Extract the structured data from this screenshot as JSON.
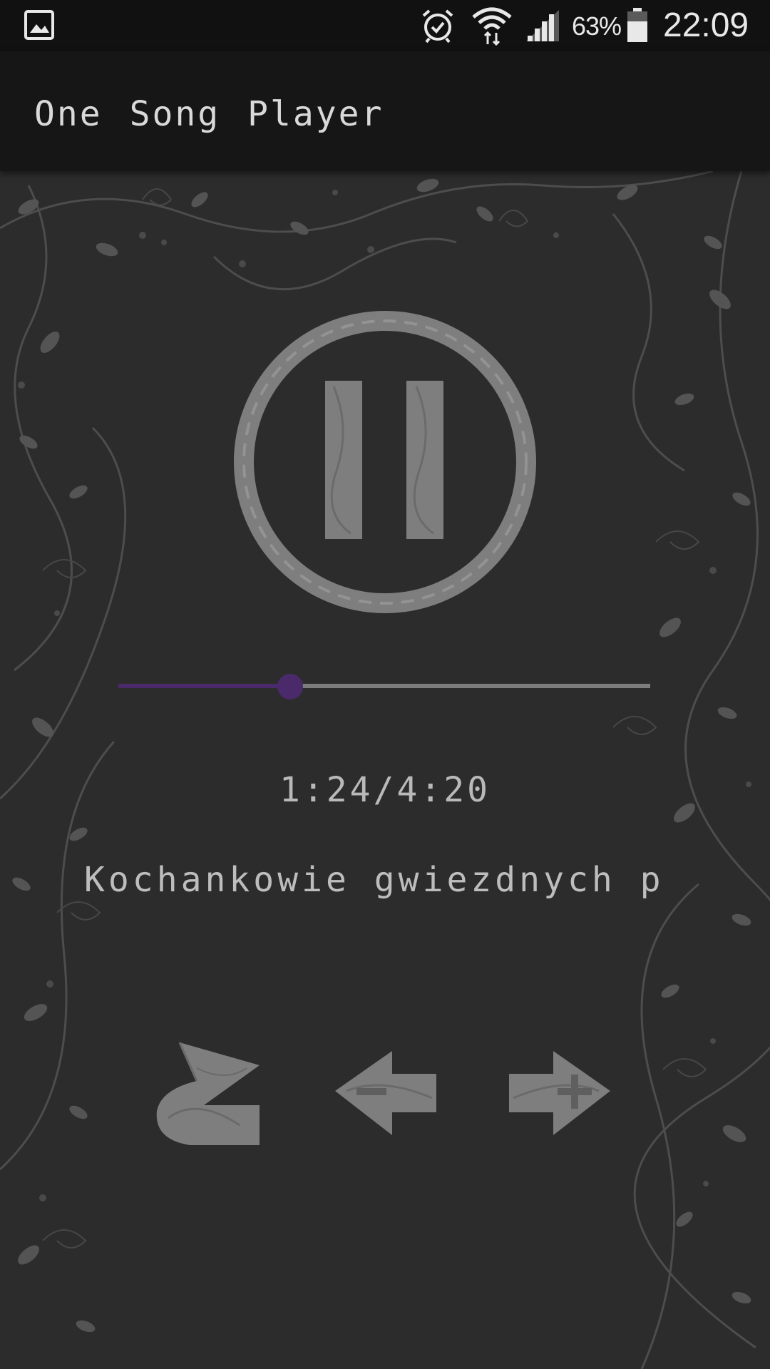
{
  "status_bar": {
    "battery_percent": "63%",
    "time": "22:09",
    "icons": [
      "gallery-icon",
      "alarm-icon",
      "wifi-icon",
      "signal-icon",
      "battery-icon"
    ]
  },
  "app_bar": {
    "title": "One Song Player"
  },
  "player": {
    "state_icon": "pause-icon",
    "progress_fraction": 0.3231,
    "time_text": "1:24/4:20",
    "song_title": "Kochankowie gwiezdnych p",
    "controls": [
      "repeat-icon",
      "minus-arrow-icon",
      "plus-arrow-icon"
    ]
  },
  "colors": {
    "background": "#2c2c2c",
    "app_bar": "#161616",
    "status_bar": "#111111",
    "accent": "#4b2a6b",
    "icon_gray": "#8a8a8a",
    "text": "#bdbdbd"
  }
}
